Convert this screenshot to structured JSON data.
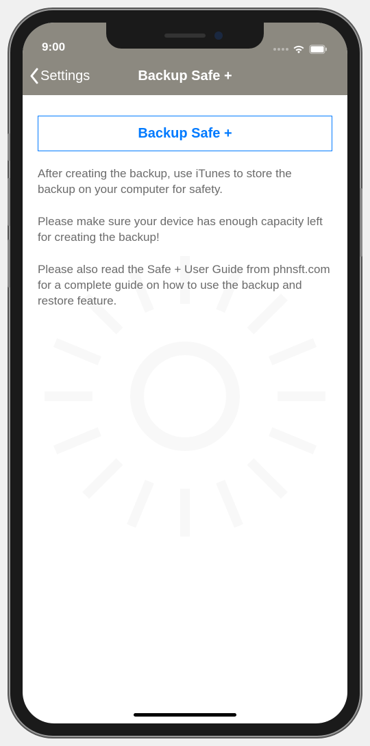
{
  "status": {
    "time": "9:00"
  },
  "nav": {
    "back_label": "Settings",
    "title": "Backup Safe +"
  },
  "content": {
    "button_label": "Backup Safe +",
    "paragraphs": [
      "After creating the backup, use iTunes to store the backup on your computer for safety.",
      "Please make sure your device has enough capacity left for creating the backup!",
      "Please also read the Safe + User Guide from phnsft.com for a complete guide on how to use the backup and restore feature."
    ]
  }
}
